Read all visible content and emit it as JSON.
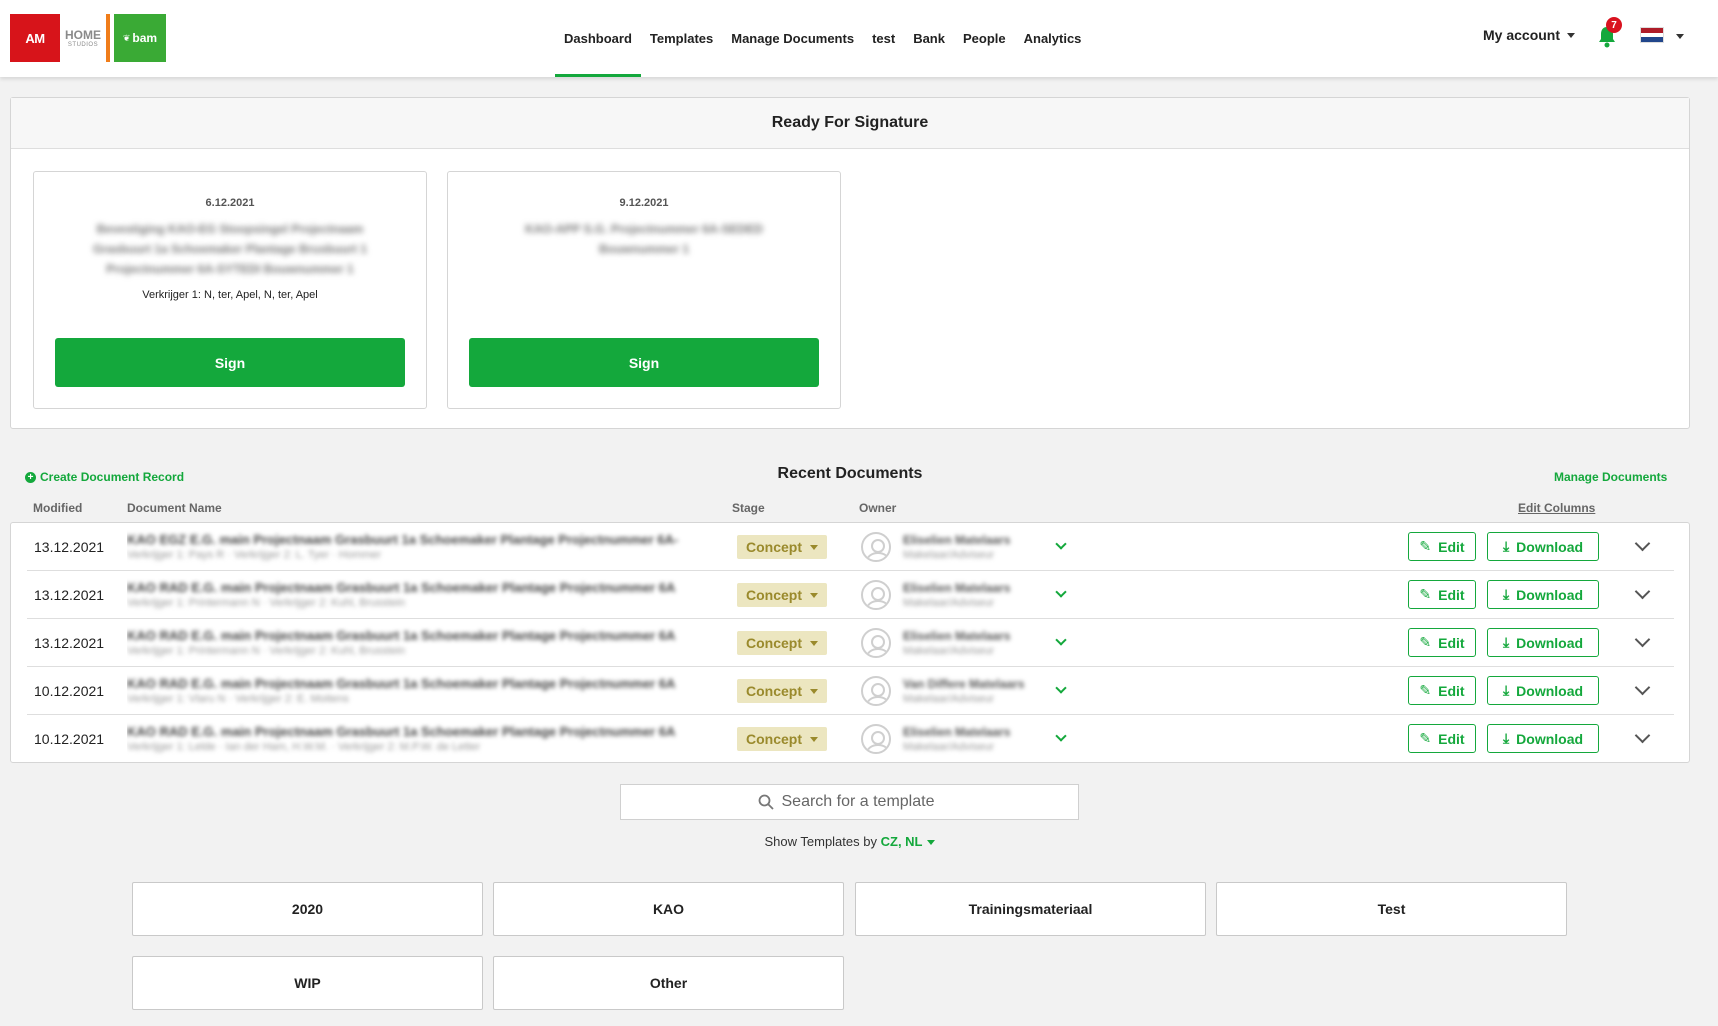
{
  "brand": {
    "logos": [
      {
        "name": "am-logo",
        "text": "AM"
      },
      {
        "name": "home-studios-logo",
        "text": "HOME",
        "subtext": "STUDIOS"
      },
      {
        "name": "bam-logo",
        "text": "bam"
      }
    ]
  },
  "nav": {
    "items": [
      {
        "label": "Dashboard",
        "active": true
      },
      {
        "label": "Templates",
        "active": false
      },
      {
        "label": "Manage Documents",
        "active": false
      },
      {
        "label": "test",
        "active": false
      },
      {
        "label": "Bank",
        "active": false
      },
      {
        "label": "People",
        "active": false
      },
      {
        "label": "Analytics",
        "active": false
      }
    ],
    "account_label": "My account",
    "notification_count": "7",
    "language_flag": "nl-flag-icon"
  },
  "signature": {
    "title": "Ready For Signature",
    "cards": [
      {
        "date": "6.12.2021",
        "title": "Bevestiging KAO-EG Stoopsingel Projectnaam Grasbuurt 1a Schoemaker Plantage Brusbuurt 1 Projectnummer 6A-SYTEDI Bouwnummer 1",
        "meta": "Verkrijger 1: N, ter, Apel, N, ter, Apel",
        "button": "Sign"
      },
      {
        "date": "9.12.2021",
        "title": "KAO-APP S.G. Projectnummer 6A-SEDED Bouwnummer 1",
        "meta": "",
        "button": "Sign"
      }
    ]
  },
  "recent": {
    "create_label": "Create Document Record",
    "title": "Recent Documents",
    "manage_label": "Manage Documents",
    "columns": {
      "modified": "Modified",
      "name": "Document Name",
      "stage": "Stage",
      "owner": "Owner",
      "edit_columns": "Edit Columns"
    },
    "rows": [
      {
        "modified": "13.12.2021",
        "name": "KAO EGZ E.G. main Projectnaam Grasbuurt 1a Schoemaker Plantage Projectnummer 6A-",
        "sub": "Verkrijger 1: Pays R · Verkrijger 2: L. Tyer · Hommer",
        "stage": "Concept",
        "owner": "Eliselien Matelaars",
        "owner_role": "Makelaar/Adviseur"
      },
      {
        "modified": "13.12.2021",
        "name": "KAO RAD E.G. main Projectnaam Grasbuurt 1a Schoemaker Plantage Projectnummer 6A",
        "sub": "Verkrijger 1: Printermann N · Verkrijger 2: Kuhl, Brusstein",
        "stage": "Concept",
        "owner": "Eliselien Matelaars",
        "owner_role": "Makelaar/Adviseur"
      },
      {
        "modified": "13.12.2021",
        "name": "KAO RAD E.G. main Projectnaam Grasbuurt 1a Schoemaker Plantage Projectnummer 6A",
        "sub": "Verkrijger 1: Printermann N · Verkrijger 2: Kuhl, Brusstein",
        "stage": "Concept",
        "owner": "Eliselien Matelaars",
        "owner_role": "Makelaar/Adviseur"
      },
      {
        "modified": "10.12.2021",
        "name": "KAO RAD E.G. main Projectnaam Grasbuurt 1a Schoemaker Plantage Projectnummer 6A",
        "sub": "Verkrijger 1: Vlaru N · Verkrijger 2: E. Moitens",
        "stage": "Concept",
        "owner": "Van Differe Matelaars",
        "owner_role": "Makelaar/Adviseur"
      },
      {
        "modified": "10.12.2021",
        "name": "KAO RAD E.G. main Projectnaam Grasbuurt 1a Schoemaker Plantage Projectnummer 6A",
        "sub": "Verkrijger 1: Lelde · Ian der Ham, H.W.M. · Verkrijger 2: M.P.W. de Letter",
        "stage": "Concept",
        "owner": "Eliselien Matelaars",
        "owner_role": "Makelaar/Adviseur"
      }
    ],
    "edit_label": "Edit",
    "download_label": "Download"
  },
  "templates": {
    "search_placeholder": "Search for a template",
    "show_by_label": "Show Templates by",
    "show_by_value": "CZ, NL",
    "folders": [
      "2020",
      "KAO",
      "Trainingsmateriaal",
      "Test",
      "WIP",
      "Other"
    ]
  },
  "colors": {
    "accent": "#14a83c",
    "stage_bg": "#ece6c0",
    "stage_text": "#9a8a2c",
    "badge_red": "#d9121f",
    "am_red": "#d7141a",
    "bam_green": "#3aaa35",
    "home_orange": "#f07d1a"
  }
}
